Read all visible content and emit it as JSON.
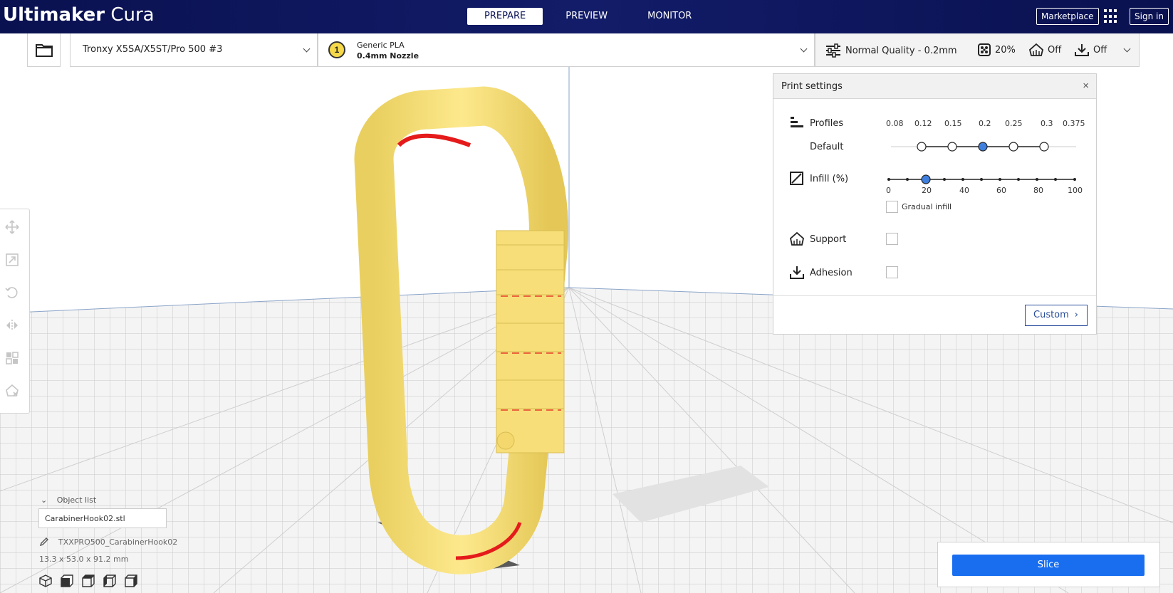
{
  "app": {
    "title_bold": "Ultimaker",
    "title_light": "Cura"
  },
  "stages": [
    {
      "label": "PREPARE"
    },
    {
      "label": "PREVIEW"
    },
    {
      "label": "MONITOR"
    }
  ],
  "header": {
    "marketplace_label": "Marketplace",
    "signin_label": "Sign in"
  },
  "toolbar": {
    "printer": "Tronxy X5SA/X5ST/Pro 500 #3",
    "extruder_number": "1",
    "material_name": "Generic PLA",
    "nozzle": "0.4mm Nozzle",
    "quality": "Normal Quality - 0.2mm",
    "infill": "20%",
    "support": "Off",
    "adhesion": "Off"
  },
  "print_settings": {
    "title": "Print settings",
    "close_glyph": "×",
    "profiles_label": "Profiles",
    "profile_value": "Default",
    "layer_heights": [
      "0.08",
      "0.12",
      "0.15",
      "0.2",
      "0.25",
      "0.3",
      "0.375"
    ],
    "selected_layer_height": "0.2",
    "infill_label": "Infill (%)",
    "infill_ticks": [
      "0",
      "20",
      "40",
      "60",
      "80",
      "100"
    ],
    "infill_value": 20,
    "gradual_infill_label": "Gradual infill",
    "support_label": "Support",
    "adhesion_label": "Adhesion",
    "custom_label": "Custom"
  },
  "object_list": {
    "header": "Object list",
    "file": "CarabinerHook02.stl",
    "job_name": "TXXPRO500_CarabinerHook02",
    "dimensions": "13.3 x 53.0 x 91.2 mm"
  },
  "slice": {
    "label": "Slice"
  },
  "icons": {
    "open": "folder-icon",
    "quality": "sliders-icon",
    "infill": "infill-icon",
    "support": "support-icon",
    "adhesion": "adhesion-icon"
  },
  "colors": {
    "header_bg": "#0b1456",
    "accent": "#196ef0",
    "model": "#f9e27b",
    "overhang": "#e51b1b"
  }
}
